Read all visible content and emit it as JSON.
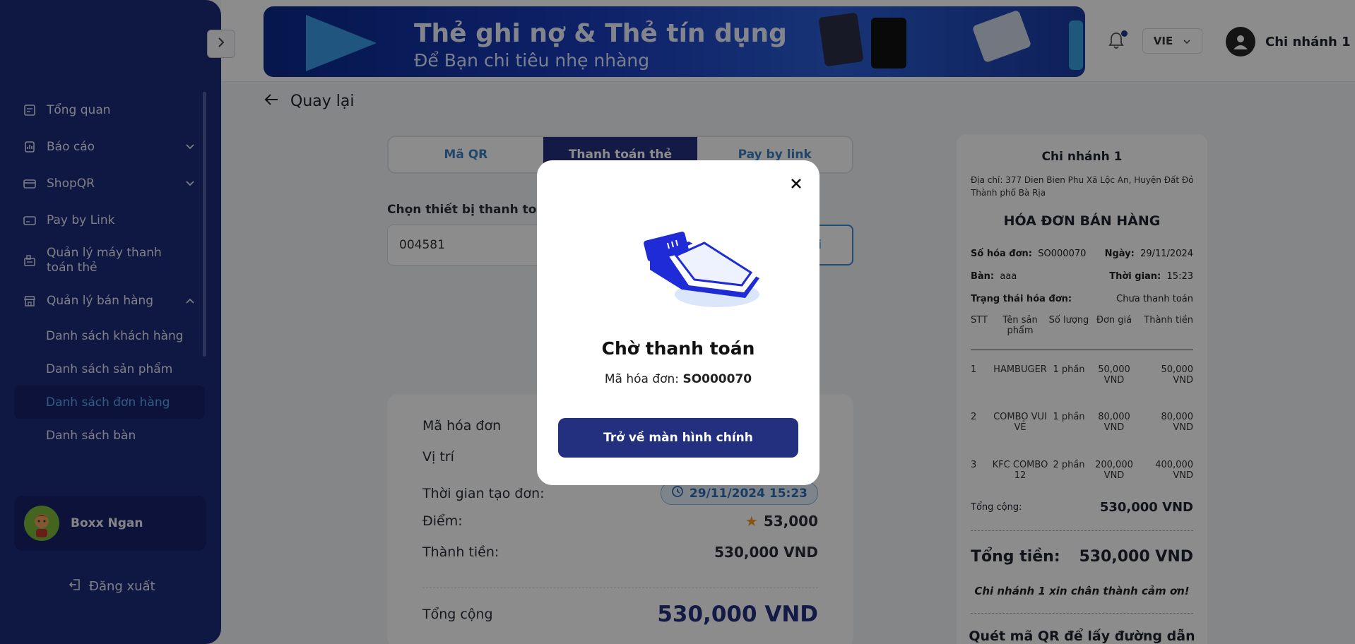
{
  "header": {
    "banner_title": "Thẻ ghi nợ & Thẻ tín dụng",
    "banner_subtitle": "Để Bạn chi tiêu nhẹ nhàng",
    "language": "VIE",
    "branch_name": "Chi nhánh 1"
  },
  "sidebar": {
    "items": [
      {
        "label": "Tổng quan",
        "icon": "dashboard-icon"
      },
      {
        "label": "Báo cáo",
        "icon": "report-icon"
      },
      {
        "label": "ShopQR",
        "icon": "card-icon"
      },
      {
        "label": "Pay by Link",
        "icon": "link-card-icon"
      },
      {
        "label": "Quản lý máy thanh toán thẻ",
        "icon": "pos-icon"
      },
      {
        "label": "Quản lý bán hàng",
        "icon": "store-icon"
      }
    ],
    "sub_items": [
      "Danh sách khách hàng",
      "Danh sách sản phẩm",
      "Danh sách đơn hàng",
      "Danh sách bàn"
    ],
    "active_sub": "Danh sách đơn hàng",
    "user_name": "Boxx Ngan",
    "logout_label": "Đăng xuất"
  },
  "page": {
    "back_label": "Quay lại",
    "tabs": [
      "Mã QR",
      "Thanh toán thẻ",
      "Pay by link"
    ],
    "active_tab": "Thanh toán thẻ",
    "device_label": "Chọn thiết bị thanh toán",
    "device_required_mark": "*",
    "device_value": "004581",
    "device_button_label": "i"
  },
  "order": {
    "code_label": "Mã hóa đơn",
    "location_label": "Vị trí",
    "created_label": "Thời gian tạo đơn:",
    "created_value": "29/11/2024 15:23",
    "points_label": "Điểm:",
    "points_value": "53,000",
    "amount_label": "Thành tiền:",
    "amount_value": "530,000 VND",
    "total_label": "Tổng cộng",
    "total_value": "530,000 VND"
  },
  "receipt": {
    "branch": "Chi nhánh 1",
    "address": "Địa chỉ: 377 Dien Bien Phu Xã Lộc An, Huyện Đất Đỏ Thành phố Bà Rịa",
    "heading": "HÓA ĐƠN BÁN HÀNG",
    "invoice_no_label": "Số hóa đơn:",
    "invoice_no": "SO000070",
    "date_label": "Ngày:",
    "date": "29/11/2024",
    "table_label": "Bàn:",
    "table": "aaa",
    "time_label": "Thời gian:",
    "time": "15:23",
    "status_label": "Trạng thái hóa đơn:",
    "status": "Chưa thanh toán",
    "columns": [
      "STT",
      "Tên sản phẩm",
      "Số lượng",
      "Đơn giá",
      "Thành tiền"
    ],
    "rows": [
      {
        "stt": "1",
        "name": "HAMBUGER",
        "qty": "1 phần",
        "price": "50,000 VND",
        "total": "50,000 VND"
      },
      {
        "stt": "2",
        "name": "COMBO VUI VẺ",
        "qty": "1 phần",
        "price": "80,000 VND",
        "total": "80,000 VND"
      },
      {
        "stt": "3",
        "name": "KFC COMBO 12",
        "qty": "2 phần",
        "price": "200,000 VND",
        "total": "400,000 VND"
      }
    ],
    "subtotal_label": "Tổng cộng:",
    "subtotal": "530,000 VND",
    "grand_label": "Tổng tiền:",
    "grand": "530,000 VND",
    "thanks": "Chi nhánh 1 xin chân thành cảm ơn!",
    "qr_text": "Quét mã QR để lấy đường dẫn"
  },
  "modal": {
    "title": "Chờ thanh toán",
    "code_label": "Mã hóa đơn:",
    "code_value": "SO000070",
    "button_label": "Trở về màn hình chính"
  },
  "colors": {
    "sidebar": "#1c2a7a",
    "primary": "#23307f",
    "accent": "#3b8ad8"
  }
}
